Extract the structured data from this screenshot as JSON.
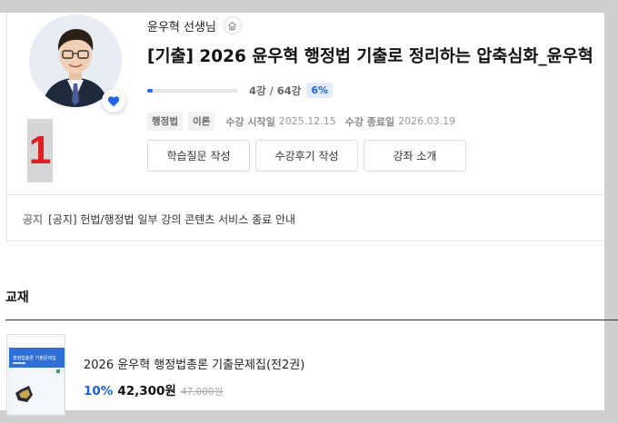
{
  "teacher": {
    "name": "윤우혁 선생님"
  },
  "course": {
    "title": "[기출] 2026 윤우혁 행정법 기출로 정리하는 압축심화_윤우혁",
    "rank": "1",
    "progress": {
      "fraction": 0.06,
      "count_text": "4강 / 64강",
      "percent_text": "6%"
    },
    "tags": [
      "행정법",
      "이론"
    ],
    "start_label": "수강 시작일",
    "start_date": "2025.12.15",
    "end_label": "수강 종료일",
    "end_date": "2026.03.19",
    "buttons": {
      "question": "학습질문 작성",
      "review": "수강후기 작성",
      "intro": "강좌 소개"
    }
  },
  "notice": {
    "label": "공지",
    "text": "[공지] 헌법/행정법 일부 강의 콘텐츠 서비스 종료 안내"
  },
  "textbook": {
    "section_title": "교재",
    "cover_text": "행정법총론 기출문제집",
    "name": "2026 윤우혁 행정법총론 기출문제집(전2권)",
    "discount": "10%",
    "price": "42,300원",
    "original_price": "47,000원"
  },
  "colors": {
    "accent": "#2463eb",
    "rank": "#e02020",
    "heart": "#2463eb"
  },
  "icons": {
    "home": "home-icon",
    "heart": "heart-icon"
  }
}
